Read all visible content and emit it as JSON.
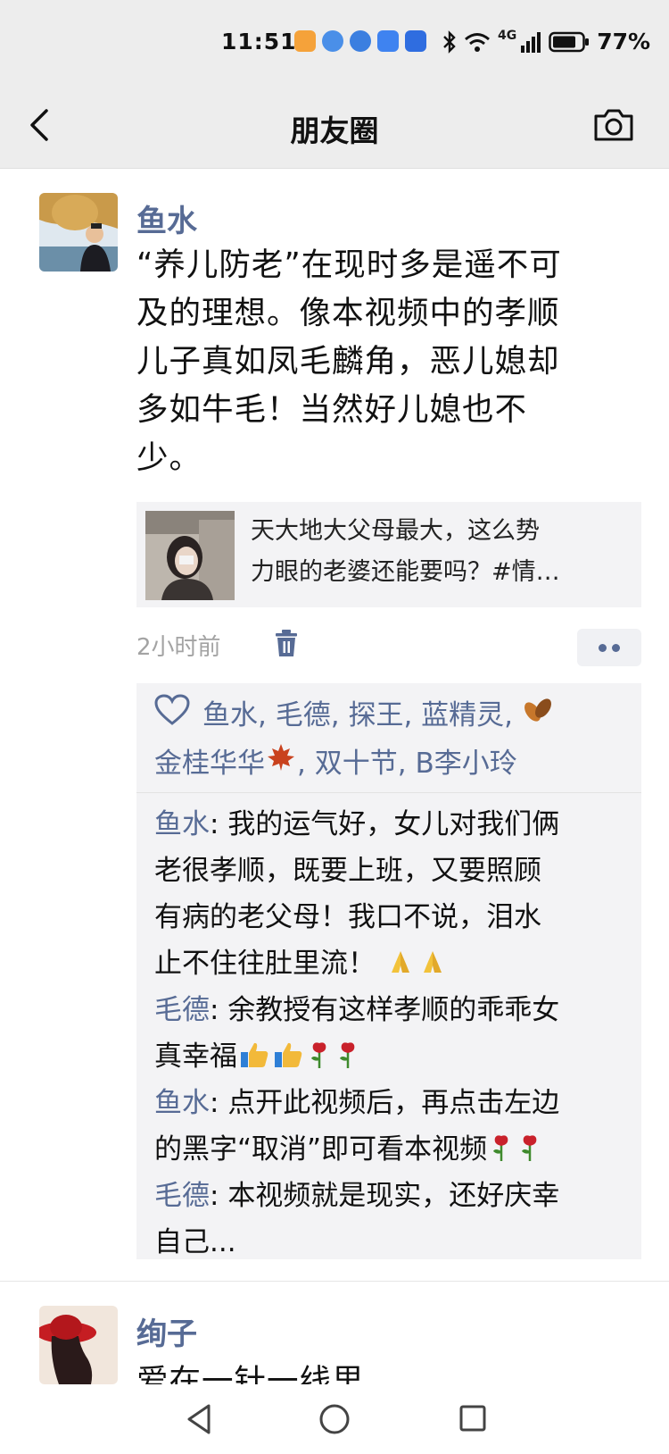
{
  "status": {
    "time": "11:51",
    "network": "4G",
    "battery": "77%"
  },
  "header": {
    "title": "朋友圈",
    "back_icon": "chevron-left-icon",
    "camera_icon": "camera-icon"
  },
  "post": {
    "author": "鱼水",
    "text_lines": [
      "“养儿防老”在现时多是遥不可",
      "及的理想。像本视频中的孝顺",
      "儿子真如凤毛麟角，恶儿媳却",
      "多如牛毛！当然好儿媳也不",
      "少。"
    ],
    "share": {
      "line1": "天大地大父母最大，这么势",
      "line2": "力眼的老婆还能要吗？#情…"
    },
    "time": "2小时前",
    "likes": {
      "names_line1": [
        "鱼水",
        "毛德",
        "探王",
        "蓝精灵"
      ],
      "names_line2": [
        "金桂华华",
        "双十节",
        "B李小玲"
      ],
      "sep": ", "
    },
    "comments": [
      {
        "name": "鱼水",
        "lines": [
          "我的运气好，女儿对我们俩",
          "老很孝顺，既要上班，又要照顾",
          "有病的老父母！我口不说，泪水",
          "止不住往肚里流！"
        ]
      },
      {
        "name": "毛德",
        "lines": [
          "余教授有这样孝顺的乖乖女",
          "真幸福"
        ]
      },
      {
        "name": "鱼水",
        "lines": [
          "点开此视频后，再点击左边",
          "的黑字“取消”即可看本视频"
        ]
      },
      {
        "name": "毛德",
        "lines": [
          "本视频就是现实，还好庆幸",
          "自己..."
        ]
      }
    ],
    "name_sep": ": "
  },
  "next_post": {
    "author": "绚子",
    "partial_text": "爱在一针一线里"
  },
  "colors": {
    "link": "#576b95",
    "bar": "#ededed",
    "card": "#f3f3f5"
  }
}
